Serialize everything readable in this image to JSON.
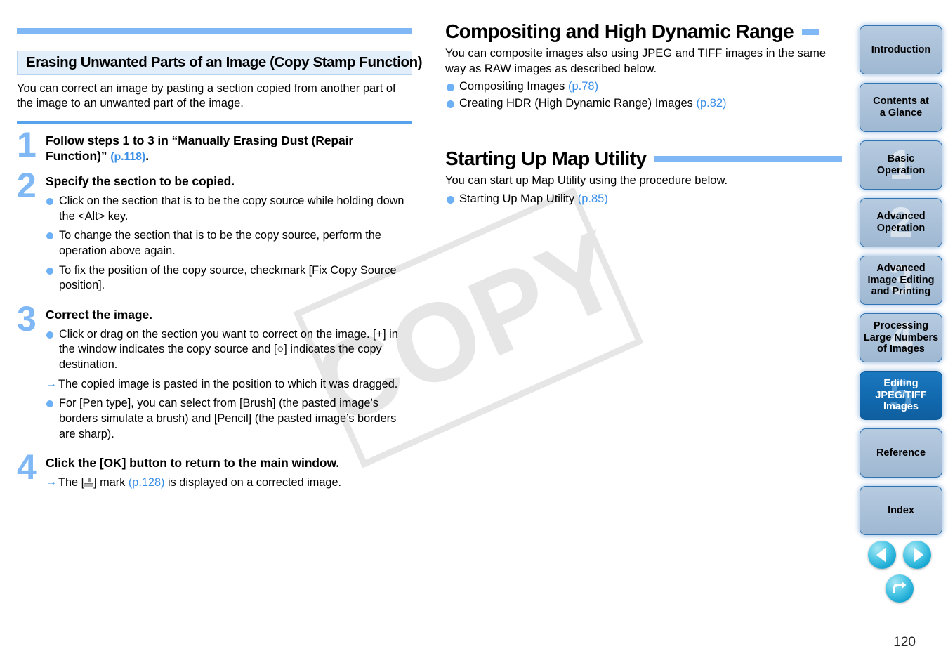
{
  "page": {
    "number": "120",
    "watermark": "COPY"
  },
  "left_column": {
    "section_title": "Erasing Unwanted Parts of an Image (Copy Stamp Function)",
    "intro": "You can correct an image by pasting a section copied from another part of the image to an unwanted part of the image.",
    "steps": [
      {
        "number": "1",
        "title_main": "Follow steps 1 to 3 in “Manually Erasing Dust (Repair Function)” ",
        "title_ref": "(p.118)",
        "title_tail": ".",
        "bullets": []
      },
      {
        "number": "2",
        "title_main": "Specify the section to be copied.",
        "title_ref": "",
        "title_tail": "",
        "bullets": [
          {
            "marker": "dot",
            "text": "Click on the section that is to be the copy source while holding down the <Alt> key."
          },
          {
            "marker": "dot",
            "text": "To change the section that is to be the copy source, perform the operation above again."
          },
          {
            "marker": "dot",
            "text": "To fix the position of the copy source, checkmark [Fix Copy Source position]."
          }
        ]
      },
      {
        "number": "3",
        "title_main": "Correct the image.",
        "title_ref": "",
        "title_tail": "",
        "bullets": [
          {
            "marker": "dot",
            "text": "Click or drag on the section you want to correct on the image. [+] in the window indicates the copy source and [○] indicates the copy destination."
          },
          {
            "marker": "arrow",
            "text": "The copied image is pasted in the position to which it was dragged."
          },
          {
            "marker": "dot",
            "text": "For [Pen type], you can select from [Brush] (the pasted image’s borders simulate a brush) and [Pencil] (the pasted image’s borders are sharp)."
          }
        ]
      },
      {
        "number": "4",
        "title_main": "Click the [OK] button to return to the main window.",
        "title_ref": "",
        "title_tail": "",
        "bullets": [
          {
            "marker": "arrow-stamp",
            "text_before": "The [",
            "text_mid": "] mark ",
            "ref": "(p.128)",
            "text_after": " is displayed on a corrected image."
          }
        ]
      }
    ]
  },
  "right_column": {
    "sections": [
      {
        "heading": "Compositing and High Dynamic Range",
        "body": "You can composite images also using JPEG and TIFF images in the same way as RAW images as described below.",
        "links": [
          {
            "text": "Compositing Images ",
            "ref": "(p.78)"
          },
          {
            "text": "Creating HDR (High Dynamic Range) Images ",
            "ref": "(p.82)"
          }
        ]
      },
      {
        "heading": "Starting Up Map Utility",
        "body": "You can start up Map Utility using the procedure below.",
        "links": [
          {
            "text": "Starting Up Map Utility ",
            "ref": "(p.85)"
          }
        ]
      }
    ]
  },
  "sidebar": {
    "tabs": [
      {
        "label": "Introduction",
        "watermark": "",
        "active": false
      },
      {
        "label": "Contents at\na Glance",
        "watermark": "",
        "active": false
      },
      {
        "label": "Basic\nOperation",
        "watermark": "1",
        "active": false
      },
      {
        "label": "Advanced\nOperation",
        "watermark": "2",
        "active": false
      },
      {
        "label": "Advanced\nImage Editing\nand Printing",
        "watermark": "3",
        "active": false
      },
      {
        "label": "Processing\nLarge Numbers\nof Images",
        "watermark": "4",
        "active": false
      },
      {
        "label": "Editing\nJPEG/TIFF\nImages",
        "watermark": "5",
        "active": true
      },
      {
        "label": "Reference",
        "watermark": "",
        "active": false
      },
      {
        "label": "Index",
        "watermark": "",
        "active": false
      }
    ]
  },
  "nav": {
    "previous": "previous-page",
    "next": "next-page",
    "back": "return-back"
  },
  "colors": {
    "accent_light_blue": "#7fb8f5",
    "accent_blue": "#56a3ec",
    "link_blue": "#3a8fe8",
    "header_box_bg": "#e2effb",
    "tab_inactive": "#afc5dc",
    "tab_active": "#1168ad",
    "nav_circle": "#17a7d2"
  }
}
